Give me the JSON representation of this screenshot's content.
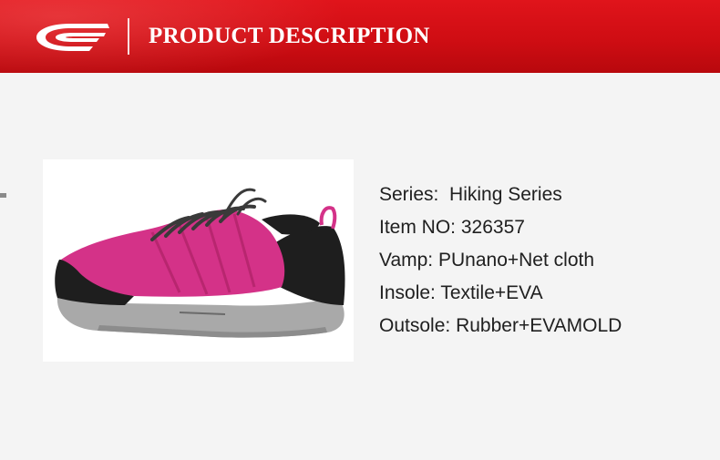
{
  "header": {
    "title": "PRODUCT DESCRIPTION",
    "logo_icon": "brand-swoosh-logo",
    "background_color": "#d0101a"
  },
  "product_image": {
    "icon": "hiking-shoe-image",
    "shoe_colors": {
      "upper": "#d43288",
      "trim": "#1e1e1e",
      "sole": "#a9a9a9"
    }
  },
  "specs": [
    {
      "label": "Series:",
      "value": "Hiking Series"
    },
    {
      "label": "Item NO:",
      "value": "326357"
    },
    {
      "label": "Vamp:",
      "value": "PUnano+Net cloth"
    },
    {
      "label": "Insole:",
      "value": "Textile+EVA"
    },
    {
      "label": "Outsole:",
      "value": "Rubber+EVAMOLD"
    }
  ]
}
